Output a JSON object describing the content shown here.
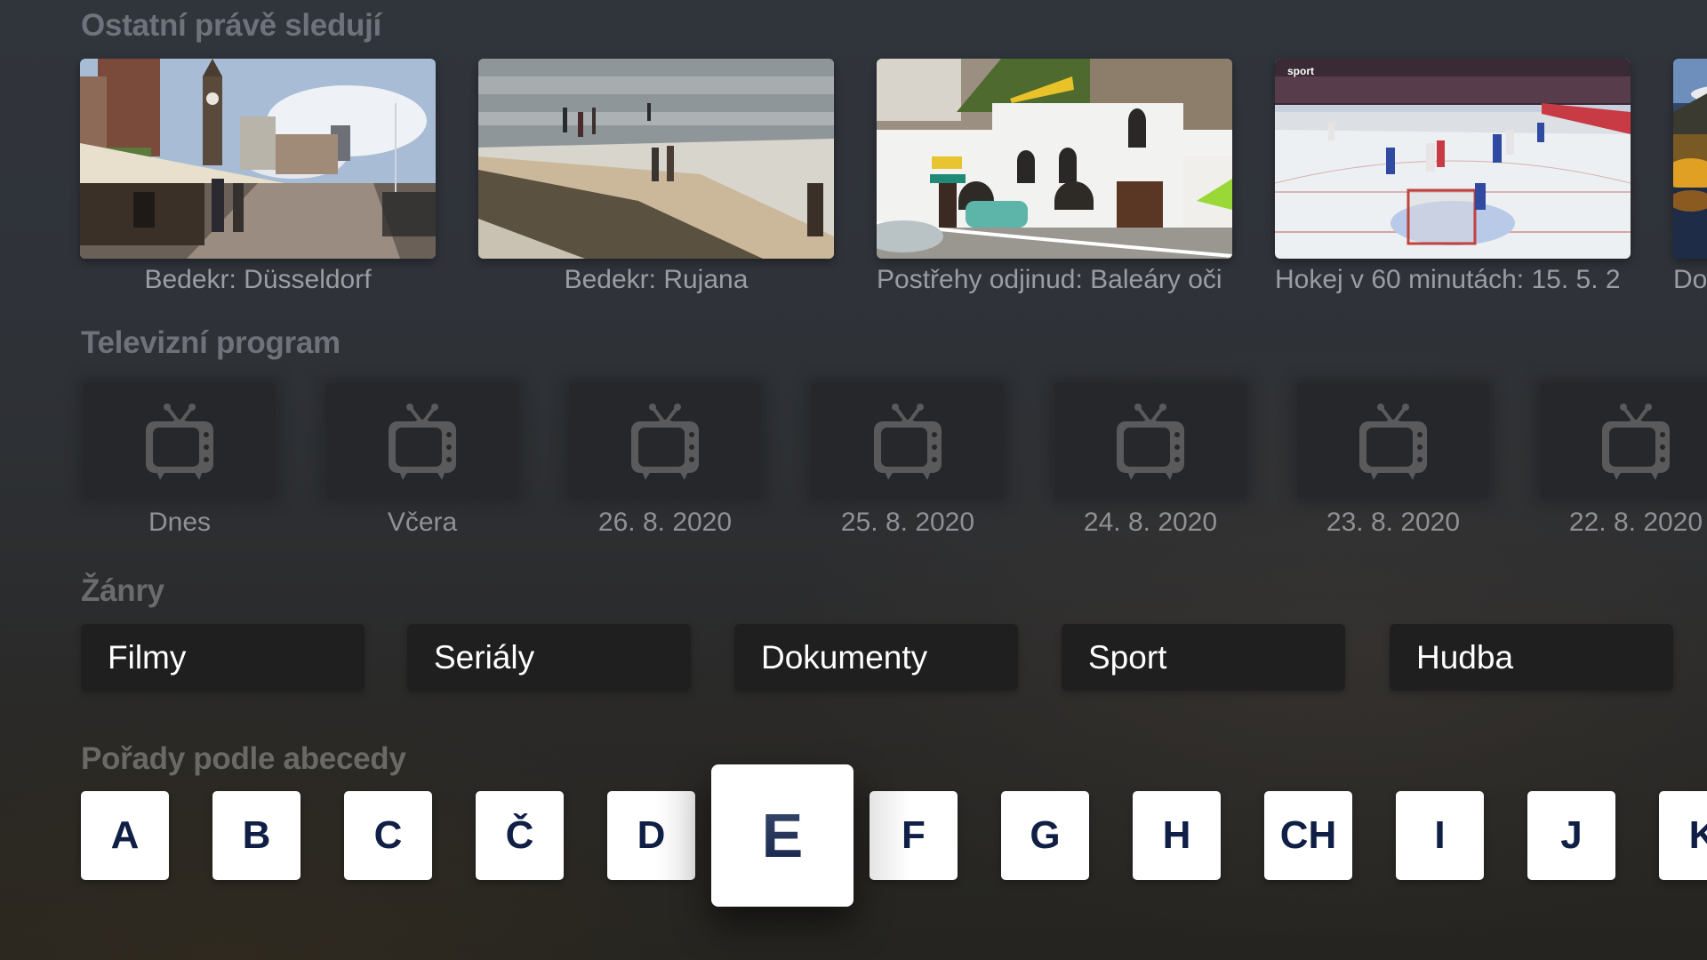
{
  "sections": {
    "watching": {
      "title": "Ostatní právě sledují",
      "items": [
        {
          "caption": "Bedekr: Düsseldorf",
          "thumbnail": "riverside-promenade-clock-tower"
        },
        {
          "caption": "Bedekr: Rujana",
          "thumbnail": "beach-sea-people"
        },
        {
          "caption": "Postřehy odjinud: Baleáry oči",
          "thumbnail": "white-building-harbour"
        },
        {
          "caption": "Hokej v 60 minutách: 15. 5. 2",
          "thumbnail": "ice-hockey-game",
          "channel_logo": "sport"
        },
        {
          "caption": "Do",
          "thumbnail": "mountain-lake-autumn"
        }
      ]
    },
    "tv_program": {
      "title": "Televizní program",
      "icon": "tv-icon",
      "items": [
        {
          "label": "Dnes"
        },
        {
          "label": "Včera"
        },
        {
          "label": "26. 8. 2020"
        },
        {
          "label": "25. 8. 2020"
        },
        {
          "label": "24. 8. 2020"
        },
        {
          "label": "23. 8. 2020"
        },
        {
          "label": "22. 8. 2020"
        }
      ]
    },
    "genres": {
      "title": "Žánry",
      "items": [
        {
          "label": "Filmy"
        },
        {
          "label": "Seriály"
        },
        {
          "label": "Dokumenty"
        },
        {
          "label": "Sport"
        },
        {
          "label": "Hudba"
        }
      ]
    },
    "alphabet": {
      "title": "Pořady podle abecedy",
      "focused": "E",
      "letters": [
        "A",
        "B",
        "C",
        "Č",
        "D",
        "E",
        "F",
        "G",
        "H",
        "CH",
        "I",
        "J",
        "K"
      ]
    }
  },
  "colors": {
    "letter_text": "#0f1f45",
    "genre_bg": "#1f1f1f",
    "heading": "#6e737b"
  }
}
